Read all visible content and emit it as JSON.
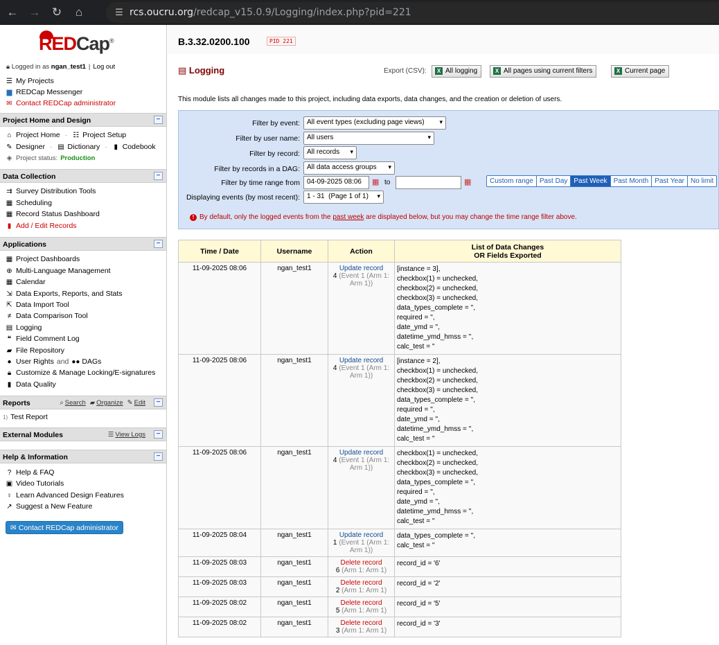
{
  "browser": {
    "url_host": "rcs.oucru.org",
    "url_path": "/redcap_v15.0.9/Logging/index.php?pid=221"
  },
  "sidebar": {
    "logo": {
      "red_part": "RED",
      "dark_part": "Cap",
      "reg": "®"
    },
    "logged_in_prefix": "Logged in as",
    "username": "ngan_test1",
    "logout": "Log out",
    "top_links": [
      {
        "label": "My Projects",
        "icon": "list-icon"
      },
      {
        "label": "REDCap Messenger",
        "icon": "chat-icon"
      },
      {
        "label": "Contact REDCap administrator",
        "icon": "mail-icon"
      }
    ],
    "project_home": {
      "title": "Project Home and Design",
      "home": "Project Home",
      "setup": "Project Setup",
      "designer": "Designer",
      "dictionary": "Dictionary",
      "codebook": "Codebook",
      "status_label": "Project status:",
      "status_value": "Production"
    },
    "data_collection": {
      "title": "Data Collection",
      "items": [
        "Survey Distribution Tools",
        "Scheduling",
        "Record Status Dashboard",
        "Add / Edit Records"
      ]
    },
    "applications": {
      "title": "Applications",
      "items": [
        "Project Dashboards",
        "Multi-Language Management",
        "Calendar",
        "Data Exports, Reports, and Stats",
        "Data Import Tool",
        "Data Comparison Tool",
        "Logging",
        "Field Comment Log",
        "File Repository",
        "User Rights",
        "Customize & Manage Locking/E-signatures",
        "Data Quality"
      ],
      "and_text": "and",
      "dags": "DAGs"
    },
    "reports": {
      "title": "Reports",
      "search": "Search",
      "organize": "Organize",
      "edit": "Edit",
      "item_num": "1)",
      "item": "Test Report"
    },
    "external_modules": {
      "title": "External Modules",
      "view_logs": "View Logs"
    },
    "help": {
      "title": "Help & Information",
      "items": [
        "Help & FAQ",
        "Video Tutorials",
        "Learn Advanced Design Features",
        "Suggest a New Feature"
      ],
      "contact_button": "Contact REDCap administrator"
    },
    "toggle": "−"
  },
  "header": {
    "project_title": "B.3.32.0200.100",
    "pid_badge": "PID 221"
  },
  "page": {
    "title": "Logging",
    "export_label": "Export (CSV):",
    "export_buttons": [
      "All logging",
      "All pages using current filters",
      "Current page"
    ],
    "description": "This module lists all changes made to this project, including data exports, data changes, and the creation or deletion of users."
  },
  "filters": {
    "event_label": "Filter by event:",
    "event_value": "All event types (excluding page views)",
    "user_label": "Filter by user name:",
    "user_value": "All users",
    "record_label": "Filter by record:",
    "record_value": "All records",
    "dag_label": "Filter by records in a DAG:",
    "dag_value": "All data access groups",
    "time_label": "Filter by time range from",
    "time_from": "04-09-2025 08:06",
    "to": "to",
    "time_to": "",
    "display_label": "Displaying events (by most recent):",
    "display_value": "1 - 31  (Page 1 of 1)",
    "range_buttons": [
      "Custom range",
      "Past Day",
      "Past Week",
      "Past Month",
      "Past Year",
      "No limit"
    ],
    "active_range": "Past Week",
    "notice_pre": "By default, only the logged events from the",
    "notice_link": "past week",
    "notice_post": "are displayed below, but you may change the time range filter above."
  },
  "table": {
    "headers": [
      "Time / Date",
      "Username",
      "Action",
      "List of Data Changes",
      "OR Fields Exported"
    ],
    "rows": [
      {
        "time": "11-09-2025 08:06",
        "user": "ngan_test1",
        "action": "Update record",
        "type": "update",
        "record": "4",
        "detail": "(Event 1 (Arm 1: Arm 1))",
        "changes": [
          "[instance = 3],",
          "checkbox(1) = unchecked,",
          "checkbox(2) = unchecked,",
          "checkbox(3) = unchecked,",
          "data_types_complete = '',",
          "required = '',",
          "date_ymd = '',",
          "datetime_ymd_hmss = '',",
          "calc_test = ''"
        ]
      },
      {
        "time": "11-09-2025 08:06",
        "user": "ngan_test1",
        "action": "Update record",
        "type": "update",
        "record": "4",
        "detail": "(Event 1 (Arm 1: Arm 1))",
        "changes": [
          "[instance = 2],",
          "checkbox(1) = unchecked,",
          "checkbox(2) = unchecked,",
          "checkbox(3) = unchecked,",
          "data_types_complete = '',",
          "required = '',",
          "date_ymd = '',",
          "datetime_ymd_hmss = '',",
          "calc_test = ''"
        ]
      },
      {
        "time": "11-09-2025 08:06",
        "user": "ngan_test1",
        "action": "Update record",
        "type": "update",
        "record": "4",
        "detail": "(Event 1 (Arm 1: Arm 1))",
        "changes": [
          "checkbox(1) = unchecked,",
          "checkbox(2) = unchecked,",
          "checkbox(3) = unchecked,",
          "data_types_complete = '',",
          "required = '',",
          "date_ymd = '',",
          "datetime_ymd_hmss = '',",
          "calc_test = ''"
        ]
      },
      {
        "time": "11-09-2025 08:04",
        "user": "ngan_test1",
        "action": "Update record",
        "type": "update",
        "record": "1",
        "detail": "(Event 1 (Arm 1: Arm 1))",
        "changes": [
          "data_types_complete = '',",
          "calc_test = ''"
        ]
      },
      {
        "time": "11-09-2025 08:03",
        "user": "ngan_test1",
        "action": "Delete record",
        "type": "delete",
        "record": "6",
        "detail": "(Arm 1: Arm 1)",
        "changes": [
          "record_id = '6'"
        ]
      },
      {
        "time": "11-09-2025 08:03",
        "user": "ngan_test1",
        "action": "Delete record",
        "type": "delete",
        "record": "2",
        "detail": "(Arm 1: Arm 1)",
        "changes": [
          "record_id = '2'"
        ]
      },
      {
        "time": "11-09-2025 08:02",
        "user": "ngan_test1",
        "action": "Delete record",
        "type": "delete",
        "record": "5",
        "detail": "(Arm 1: Arm 1)",
        "changes": [
          "record_id = '5'"
        ]
      },
      {
        "time": "11-09-2025 08:02",
        "user": "ngan_test1",
        "action": "Delete record",
        "type": "delete",
        "record": "3",
        "detail": "(Arm 1: Arm 1)",
        "changes": [
          "record_id = '3'"
        ]
      }
    ]
  }
}
